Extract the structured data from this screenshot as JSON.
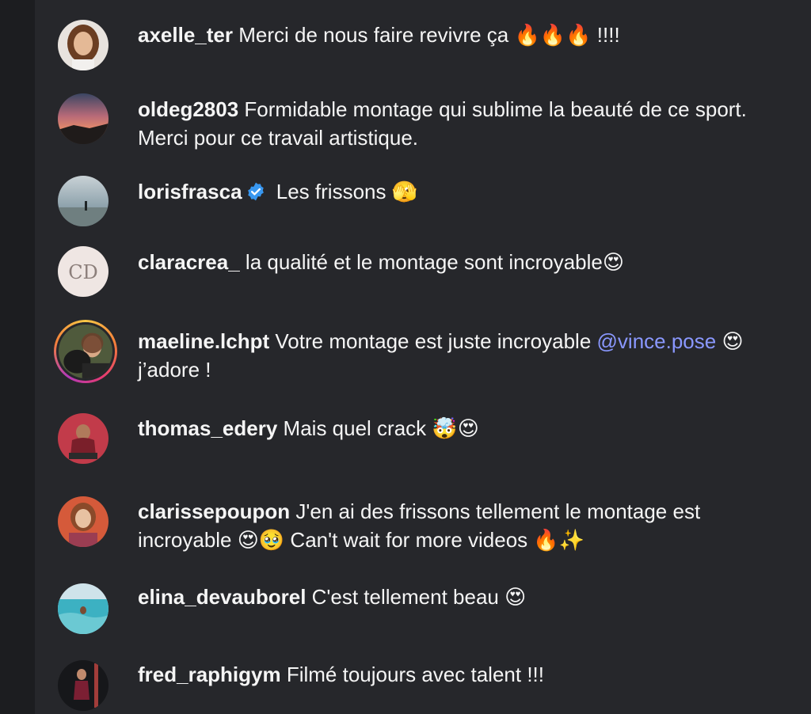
{
  "comments": [
    {
      "username": "axelle_ter",
      "text": "Merci de nous faire revivre ça 🔥🔥🔥 !!!!"
    },
    {
      "username": "oldeg2803",
      "text": "Formidable montage qui sublime la beauté de ce sport. Merci pour ce travail artistique."
    },
    {
      "username": "lorisfrasca",
      "verified": true,
      "text": "Les frissons 🫣"
    },
    {
      "username": "claracrea_",
      "avatar_text": "CD",
      "text": "la qualité et le montage sont incroyable😍"
    },
    {
      "username": "maeline.lchpt",
      "has_story": true,
      "text_before": "Votre montage est juste incroyable",
      "mention": "@vince.pose",
      "text_after": "😍 j’adore !"
    },
    {
      "username": "thomas_edery",
      "text": "Mais quel crack 🤯😍"
    },
    {
      "username": "clarissepoupon",
      "text": "J'en ai des frissons tellement le montage est incroyable 😍🥹 Can't wait for more videos 🔥✨"
    },
    {
      "username": "elina_devauborel",
      "text": "C'est tellement beau 😍"
    },
    {
      "username": "fred_raphigym",
      "text": "Filmé toujours avec talent !!!"
    }
  ],
  "colors": {
    "background": "#26272b",
    "text": "#f5f5f5",
    "mention": "#8a98ff",
    "verified": "#3897f0"
  },
  "icons": {
    "verified": "verified-badge-icon"
  }
}
